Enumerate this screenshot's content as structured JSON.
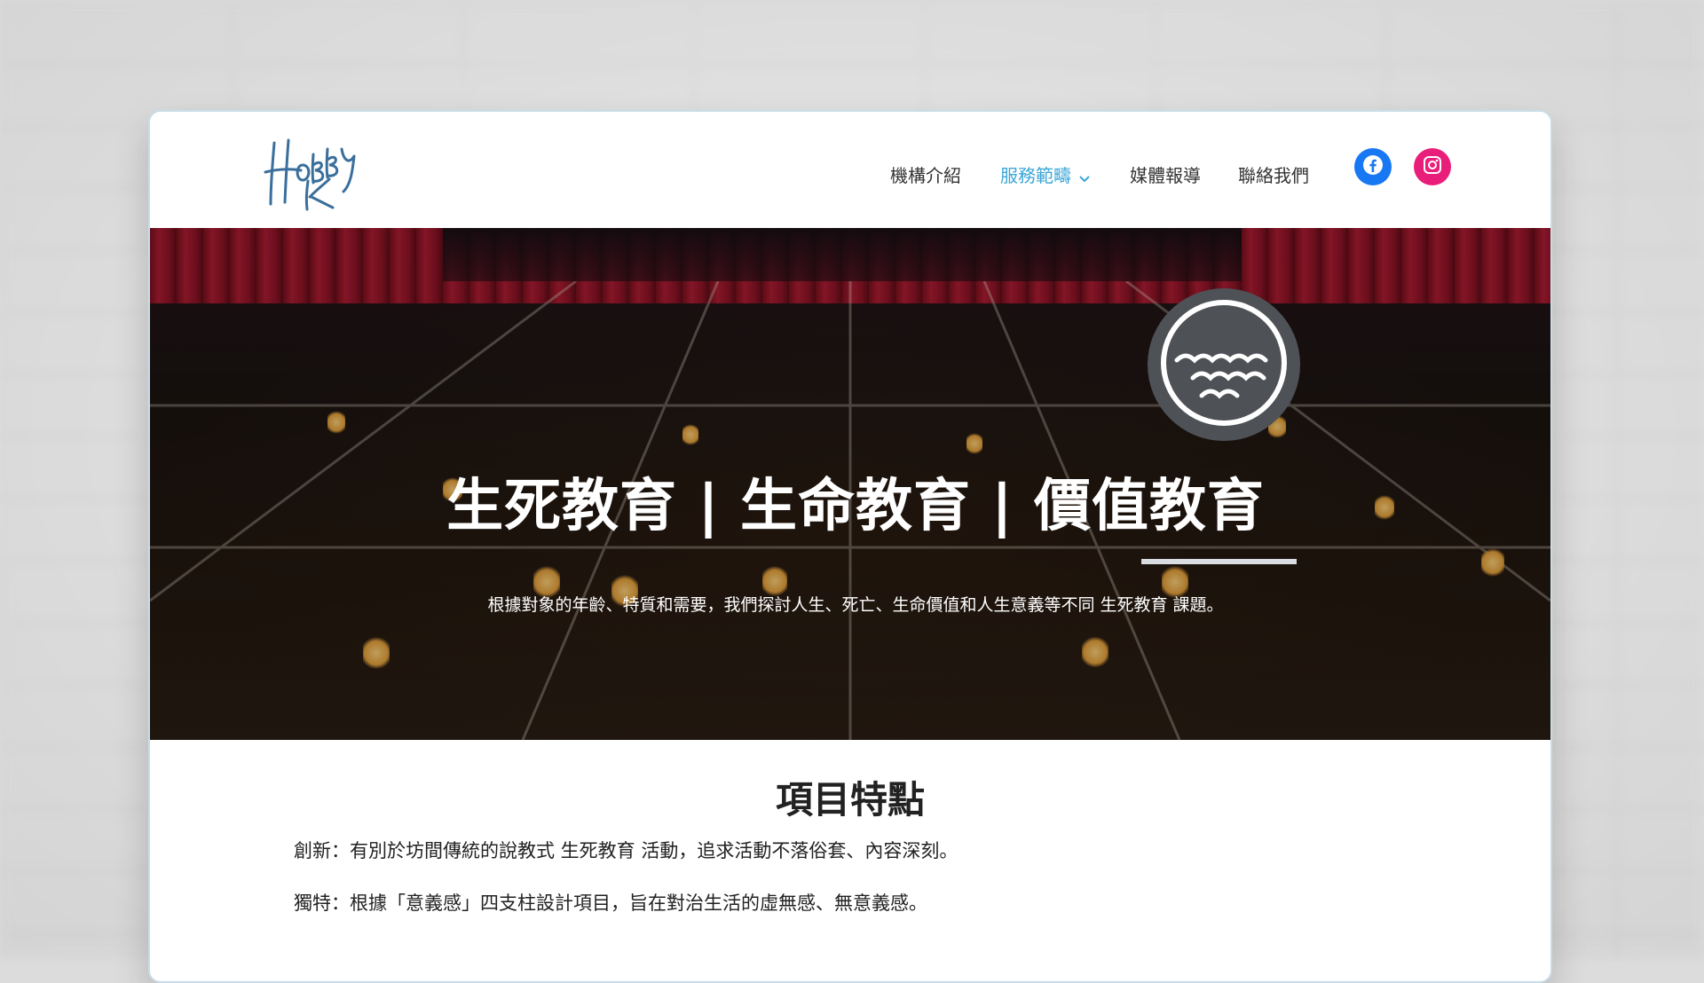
{
  "nav": {
    "items": [
      {
        "label": "機構介紹"
      },
      {
        "label": "服務範疇",
        "active": true
      },
      {
        "label": "媒體報導"
      },
      {
        "label": "聯絡我們"
      }
    ]
  },
  "social": {
    "facebook_icon": "facebook-icon",
    "instagram_icon": "instagram-icon",
    "facebook_color": "#1877f2",
    "instagram_color": "#e4405f"
  },
  "hero": {
    "title_parts": [
      "生死教育",
      " | ",
      "生命教育",
      " | ",
      "價值教育"
    ],
    "subtitle": "根據對象的年齡、特質和需要，我們探討人生、死亡、生命價值和人生意義等不同 生死教育 課題。",
    "badge_icon": "waves-icon"
  },
  "section": {
    "title": "項目特點",
    "paragraphs": [
      "創新：有別於坊間傳統的說教式 生死教育 活動，追求活動不落俗套、內容深刻。",
      "獨特：根據「意義感」四支柱設計項目，旨在對治生活的虛無感、無意義感。"
    ]
  },
  "colors": {
    "accent": "#3aa6d8",
    "badge": "#4e5257"
  }
}
